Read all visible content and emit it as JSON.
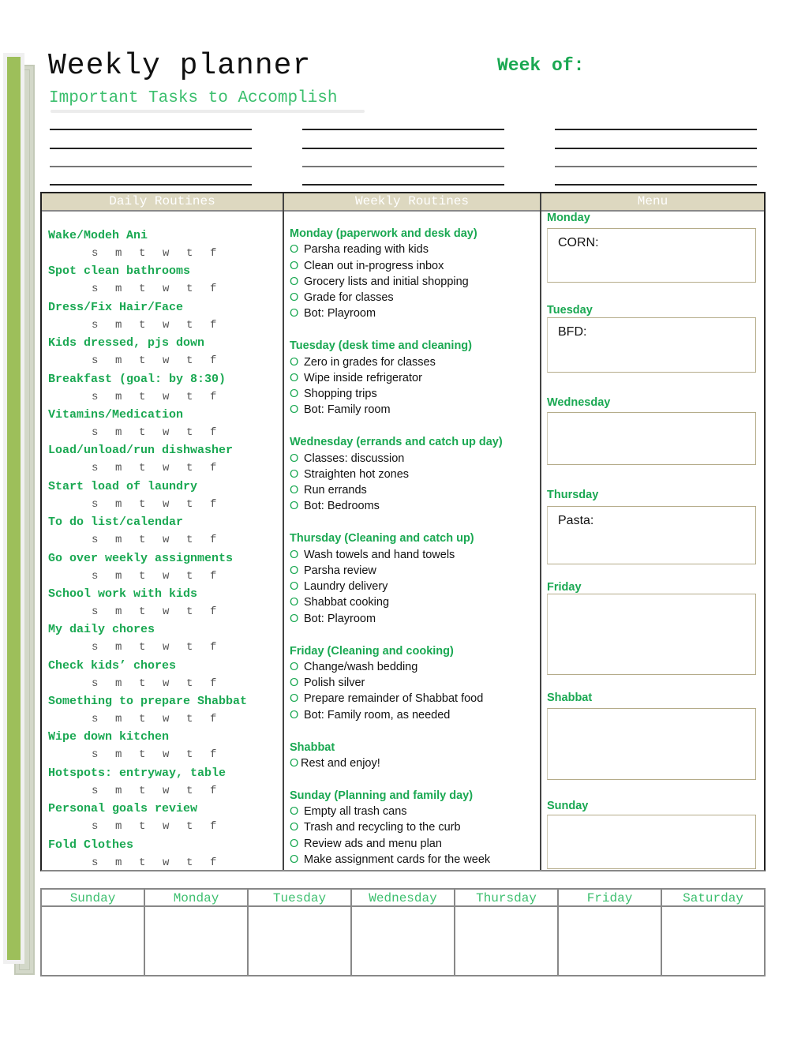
{
  "header": {
    "title": "Weekly planner",
    "week_of_label": "Week of:",
    "subtitle": "Important Tasks to Accomplish"
  },
  "colors": {
    "accent_green": "#1aa852",
    "light_green": "#3cbf6e",
    "sidebar_green": "#9dbf5a",
    "header_tan": "#ddd8c0"
  },
  "columns": {
    "daily": "Daily Routines",
    "weekly": "Weekly Routines",
    "menu": "Menu"
  },
  "day_letters": [
    "s",
    "m",
    "t",
    "w",
    "t",
    "f"
  ],
  "daily_routines": [
    "Wake/Modeh Ani",
    "Spot clean bathrooms",
    "Dress/Fix Hair/Face",
    "Kids dressed, pjs down",
    "Breakfast (goal: by 8:30)",
    "Vitamins/Medication",
    "Load/unload/run dishwasher",
    "Start load of laundry",
    "To do list/calendar",
    "Go over weekly assignments",
    "School work with kids",
    "My daily chores",
    "Check kids’ chores",
    "Something to prepare Shabbat",
    "Wipe down kitchen",
    "Hotspots: entryway, table",
    "Personal goals review",
    "Fold Clothes"
  ],
  "bullet": "O",
  "weekly_routines": [
    {
      "heading": "Monday (paperwork and desk day)",
      "items": [
        "Parsha reading with kids",
        "Clean out in-progress inbox",
        "Grocery lists and initial shopping",
        "Grade for classes",
        "Bot: Playroom"
      ]
    },
    {
      "heading": "Tuesday (desk time and cleaning)",
      "items": [
        "Zero in grades for classes",
        "Wipe inside refrigerator",
        "Shopping trips",
        "Bot: Family room"
      ]
    },
    {
      "heading": "Wednesday (errands and catch up day)",
      "items": [
        "Classes: discussion",
        "Straighten hot zones",
        "Run errands",
        "Bot: Bedrooms"
      ]
    },
    {
      "heading": "Thursday (Cleaning and catch up)",
      "items": [
        "Wash towels and hand towels",
        "Parsha review",
        "Laundry delivery",
        "Shabbat cooking",
        "Bot: Playroom"
      ]
    },
    {
      "heading": "Friday (Cleaning and cooking)",
      "items": [
        "Change/wash bedding",
        "Polish silver",
        "Prepare remainder of Shabbat food",
        "Bot: Family room, as needed"
      ]
    },
    {
      "heading": "Shabbat",
      "items": [
        "Rest and enjoy!"
      ]
    },
    {
      "heading": "Sunday (Planning and family day)",
      "items": [
        "Empty all trash cans",
        "Trash and recycling to the curb",
        "Review ads and menu plan",
        "Make assignment cards for the week"
      ]
    }
  ],
  "menu": [
    {
      "day": "Monday",
      "text": "CORN:"
    },
    {
      "day": "Tuesday",
      "text": "BFD:"
    },
    {
      "day": "Wednesday",
      "text": ""
    },
    {
      "day": "Thursday",
      "text": "Pasta:"
    },
    {
      "day": "Friday",
      "text": ""
    },
    {
      "day": "Shabbat",
      "text": ""
    },
    {
      "day": "Sunday",
      "text": ""
    }
  ],
  "week_grid": [
    "Sunday",
    "Monday",
    "Tuesday",
    "Wednesday",
    "Thursday",
    "Friday",
    "Saturday"
  ]
}
